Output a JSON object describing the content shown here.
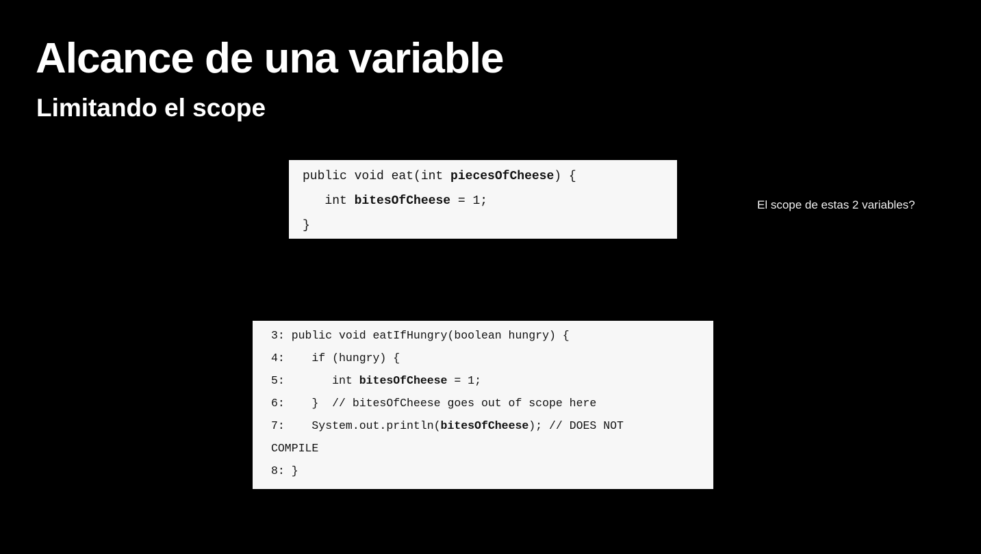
{
  "slide": {
    "title": "Alcance de una variable",
    "subtitle": "Limitando el scope",
    "side_note": "El scope de estas 2 variables?"
  },
  "code_example_1": {
    "line1": {
      "pre": "public void eat(int ",
      "bold": "piecesOfCheese",
      "post": ") {"
    },
    "line2": {
      "pre": "   int ",
      "bold": "bitesOfCheese",
      "post": " = 1;"
    },
    "line3": "}"
  },
  "code_example_2": {
    "line3": "3: public void eatIfHungry(boolean hungry) {",
    "line4": "4:    if (hungry) {",
    "line5": {
      "pre": "5:       int ",
      "bold": "bitesOfCheese",
      "post": " = 1;"
    },
    "line6": "6:    }  // bitesOfCheese goes out of scope here",
    "line7": {
      "pre": "7:    System.out.println(",
      "bold": "bitesOfCheese",
      "post": "); // DOES NOT"
    },
    "line7_wrap": "COMPILE",
    "line8": "8: }"
  },
  "colors": {
    "background": "#000000",
    "text": "#ffffff",
    "code_bg": "#f7f7f7",
    "code_text": "#111111"
  }
}
